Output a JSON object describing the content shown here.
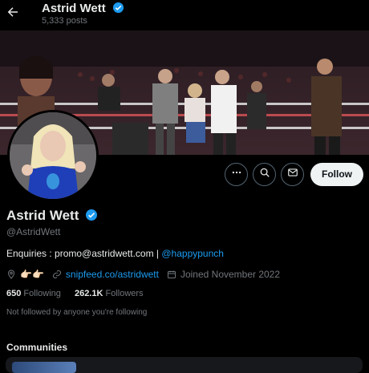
{
  "header": {
    "back_icon": "arrow-left-icon",
    "name": "Astrid Wett",
    "posts": "5,333 posts"
  },
  "profile": {
    "name": "Astrid Wett",
    "handle": "@AstridWett",
    "verified": true,
    "bio_text": "Enquiries : promo@astridwett.com | ",
    "bio_link": "@happypunch",
    "location": "👉🏻👉🏻",
    "website": "snipfeed.co/astridwett",
    "joined": "Joined November 2022"
  },
  "actions": {
    "follow_label": "Follow",
    "more_icon": "more-icon",
    "search_icon": "search-icon",
    "message_icon": "mail-icon"
  },
  "stats": {
    "following_count": "650",
    "following_label": "Following",
    "followers_count": "262.1K",
    "followers_label": "Followers"
  },
  "not_followed": "Not followed by anyone you're following",
  "communities": {
    "title": "Communities"
  },
  "colors": {
    "accent": "#1d9bf0",
    "background": "#000000",
    "text": "#e7e9ea",
    "muted": "#71767b"
  }
}
